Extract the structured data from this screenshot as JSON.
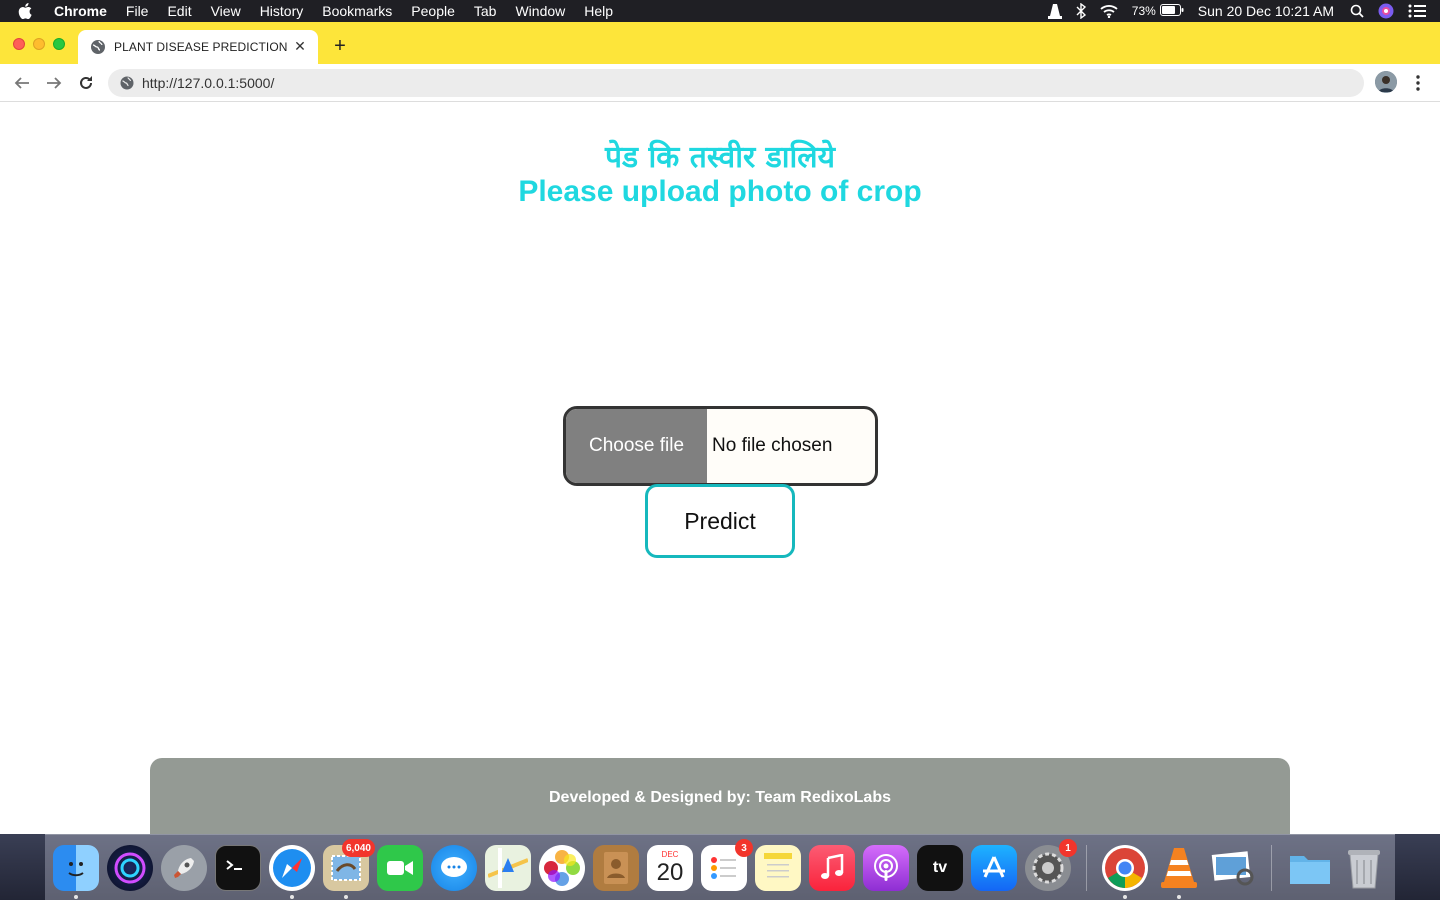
{
  "menubar": {
    "app_name": "Chrome",
    "items": [
      "File",
      "Edit",
      "View",
      "History",
      "Bookmarks",
      "People",
      "Tab",
      "Window",
      "Help"
    ],
    "battery": "73%",
    "clock": "Sun 20 Dec  10:21 AM"
  },
  "browser": {
    "tab_title": "PLANT DISEASE PREDICTION",
    "url": "http://127.0.0.1:5000/"
  },
  "page": {
    "heading_hindi": "पेड कि तस्वीर डालिये",
    "heading_english": "Please upload photo of crop",
    "choose_file_label": "Choose file",
    "no_file_label": "No file chosen",
    "predict_label": "Predict",
    "footer_text": "Developed & Designed by: Team RedixoLabs"
  },
  "dock": {
    "mail_badge": "6,040",
    "reminders_badge": "3",
    "settings_badge": "1",
    "calendar_month": "DEC",
    "calendar_day": "20",
    "tv_label": "tv"
  },
  "colors": {
    "heading": "#1fd8e0",
    "tabbar": "#fde53a",
    "predict_border": "#16b8bd",
    "footer": "#949a94"
  }
}
